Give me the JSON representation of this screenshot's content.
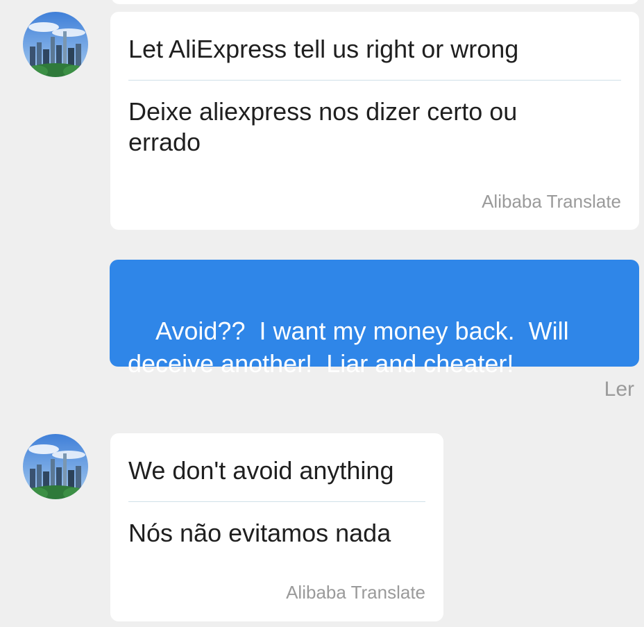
{
  "messages": [
    {
      "direction": "incoming",
      "avatar_icon": "city-skyline-avatar",
      "original": "Let AliExpress tell us right or wrong",
      "translation": "Deixe aliexpress nos dizer certo ou errado",
      "provider": "Alibaba Translate"
    },
    {
      "direction": "outgoing",
      "text": "Avoid??  I want my money back.  Will deceive another!  Liar and cheater!",
      "status": "Ler"
    },
    {
      "direction": "incoming",
      "avatar_icon": "city-skyline-avatar",
      "original": "We don't avoid anything",
      "translation": "Nós não evitamos nada",
      "provider": "Alibaba Translate"
    }
  ],
  "colors": {
    "background": "#efefef",
    "incoming_bubble": "#ffffff",
    "outgoing_bubble": "#2f86e8",
    "meta_text": "#9a9a9a"
  }
}
